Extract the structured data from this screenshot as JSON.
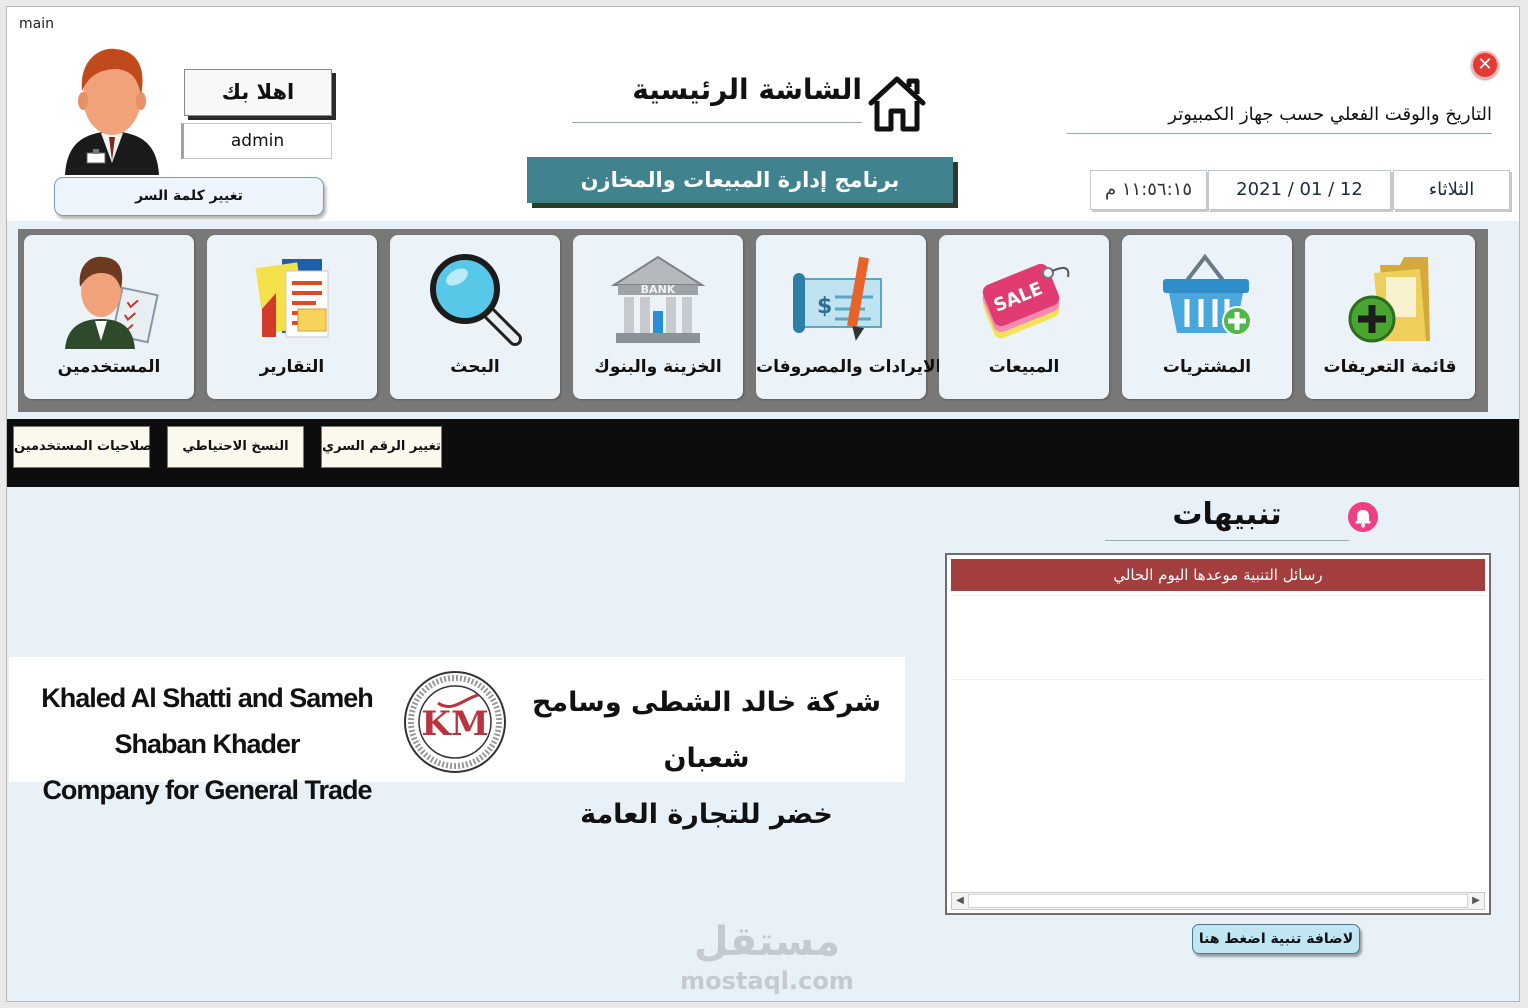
{
  "window": {
    "title": "main"
  },
  "header": {
    "close_icon": "close-x-red-circle",
    "datetime_heading": "التاريخ والوقت الفعلي حسب جهاز الكمبيوتر",
    "day": "الثلاثاء",
    "date": "2021 / 01 / 12",
    "time": "١١:٥٦:١٥ م",
    "main_title": "الشاشة الرئيسية",
    "home_icon": "home-icon",
    "program_name": "برنامج إدارة المبيعات والمخازن",
    "welcome": "اهلا بك",
    "username": "admin",
    "change_password": "تغيير كلمة السر"
  },
  "tiles": [
    {
      "label": "المستخدمين",
      "icon": "users-manager-icon"
    },
    {
      "label": "التقارير",
      "icon": "reports-icon"
    },
    {
      "label": "البحث",
      "icon": "magnifier-icon"
    },
    {
      "label": "الخزينة والبنوك",
      "icon": "bank-icon",
      "icon_text": "BANK"
    },
    {
      "label": "الايرادات والمصروفات",
      "icon": "cheque-pen-icon"
    },
    {
      "label": "المبيعات",
      "icon": "sale-tag-icon",
      "icon_text": "SALE"
    },
    {
      "label": "المشتريات",
      "icon": "basket-plus-icon"
    },
    {
      "label": "قائمة التعريفات",
      "icon": "folder-plus-icon"
    }
  ],
  "toolbar": {
    "permissions": "صلاحيات المستخدمين",
    "backup": "النسخ الاحتياطي",
    "change_pin": "تغيير الرقم السري"
  },
  "alerts": {
    "title": "تنبيهات",
    "bell_icon": "bell-icon",
    "header": "رسائل التنبية موعدها اليوم الحالي",
    "add_button": "لاضافة تنبية اضغط هنا"
  },
  "company": {
    "name_en_line1": "Khaled Al Shatti and Sameh Shaban Khader",
    "name_en_line2": "Company for General Trade",
    "name_ar_line1": "شركة خالد الشطى وسامح شعبان",
    "name_ar_line2": "خضر للتجارة العامة",
    "seal_letters": "KM"
  },
  "watermark": {
    "ar": "مستقل",
    "en": "mostaql.com"
  },
  "colors": {
    "program_bar": "#41828f",
    "alerts_header": "#a23e3e",
    "tiles_panel": "#787878",
    "toolbar_strip": "#0d0d0d",
    "body_bg": "#e8f1f7"
  }
}
